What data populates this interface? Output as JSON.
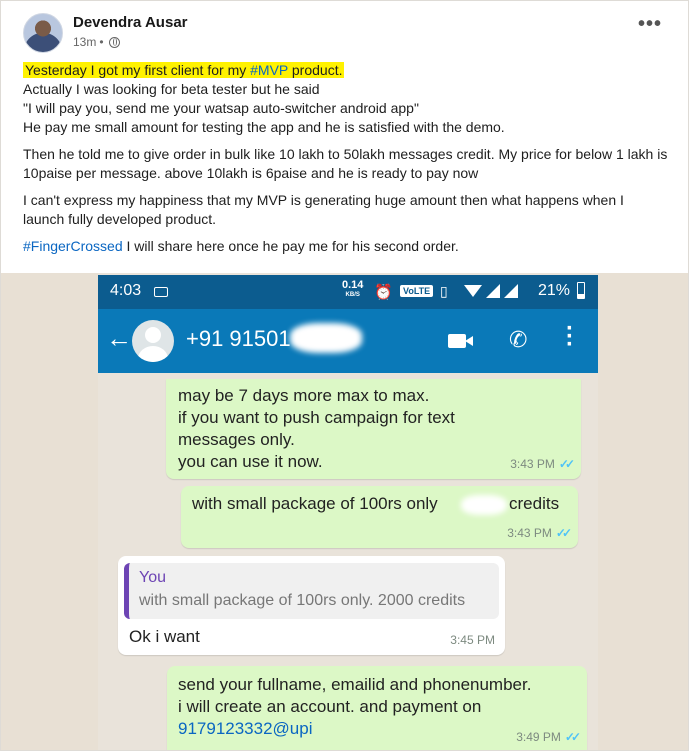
{
  "post": {
    "author": "Devendra Ausar",
    "time": "13m",
    "dot": "•",
    "more_icon": "more-options-icon",
    "paragraph1": {
      "highlight_pre": "Yesterday I got my first client for my ",
      "highlight_tag": "#MVP",
      "highlight_post": " product.",
      "line2": "Actually I was looking for beta tester but he said",
      "line3": "\"I will pay you, send me your watsap auto-switcher android app\"",
      "line4": "He pay me small amount for testing the app and he is satisfied with the demo."
    },
    "paragraph2": "Then he told me to give order in bulk like 10 lakh to 50lakh messages credit. My price for below 1 lakh is 10paise per message. above 10lakh is 6paise and he is ready to pay now",
    "paragraph3": "I can't express my happiness that my MVP is generating huge amount then what happens when I launch fully developed product.",
    "paragraph4": {
      "tag": "#FingerCrossed",
      "text": " I will share here once he pay me for his second order."
    },
    "highlight_color": "#fff200",
    "link_color": "#0a66c2"
  },
  "screenshot": {
    "status": {
      "time": "4:03",
      "speed": "0.14",
      "speed_unit": "KB/S",
      "alarm": "⏰",
      "volte": "VoLTE",
      "vibrate": "▯",
      "battery": "21%"
    },
    "chat": {
      "back": "←",
      "contact": "+91 91501",
      "call": "✆",
      "kebab": "⋮"
    },
    "messages": [
      {
        "lines": [
          "may be 7 days more max to max.",
          "if you want to push campaign for text",
          "messages only.",
          "you can use it now."
        ],
        "time": "3:43 PM"
      },
      {
        "text": "with small package of 100rs only",
        "text2": "credits",
        "time": "3:43 PM"
      },
      {
        "quote_name": "You",
        "quote_text": "with small package of 100rs only. 2000 credits",
        "text": "Ok i want",
        "time": "3:45 PM"
      },
      {
        "lines": [
          "send your fullname, emailid and phonenumber.",
          "i will create an account. and payment on"
        ],
        "upi": "9179123332@upi",
        "time": "3:49 PM"
      }
    ],
    "ticks": "✓✓",
    "colors": {
      "status_bar": "#0c5c8f",
      "app_bar": "#0a79b8",
      "outgoing": "#dcf8c6",
      "incoming": "#ffffff",
      "quote_accent": "#6d44b4",
      "tick": "#4fc3f7"
    }
  }
}
